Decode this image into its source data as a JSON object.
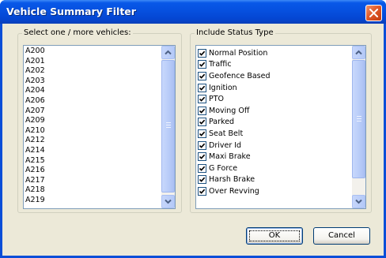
{
  "window": {
    "title": "Vehicle Summary Filter"
  },
  "vehicles": {
    "legend": "Select one / more vehicles:",
    "items": [
      "A200",
      "A201",
      "A202",
      "A203",
      "A204",
      "A206",
      "A207",
      "A209",
      "A210",
      "A212",
      "A214",
      "A215",
      "A216",
      "A217",
      "A218",
      "A219"
    ]
  },
  "status": {
    "legend": "Include Status Type",
    "items": [
      {
        "label": "Normal Position",
        "checked": true
      },
      {
        "label": "Traffic",
        "checked": true
      },
      {
        "label": "Geofence Based",
        "checked": true
      },
      {
        "label": "Ignition",
        "checked": true
      },
      {
        "label": "PTO",
        "checked": true
      },
      {
        "label": "Moving Off",
        "checked": true
      },
      {
        "label": "Parked",
        "checked": true
      },
      {
        "label": "Seat Belt",
        "checked": true
      },
      {
        "label": "Driver Id",
        "checked": true
      },
      {
        "label": "Maxi Brake",
        "checked": true
      },
      {
        "label": "G Force",
        "checked": true
      },
      {
        "label": "Harsh Brake",
        "checked": true
      },
      {
        "label": "Over Revving",
        "checked": true
      }
    ]
  },
  "buttons": {
    "ok_label": "OK",
    "cancel_label": "Cancel"
  },
  "colors": {
    "titlebar": "#0650df",
    "dialog_face": "#ece9d8",
    "close_button": "#e05a2a",
    "checkmark": "#21a121"
  },
  "icons": {
    "close": "close-icon",
    "scroll_up": "scroll-up-arrow-icon",
    "scroll_down": "scroll-down-arrow-icon",
    "check": "checkmark-icon"
  }
}
